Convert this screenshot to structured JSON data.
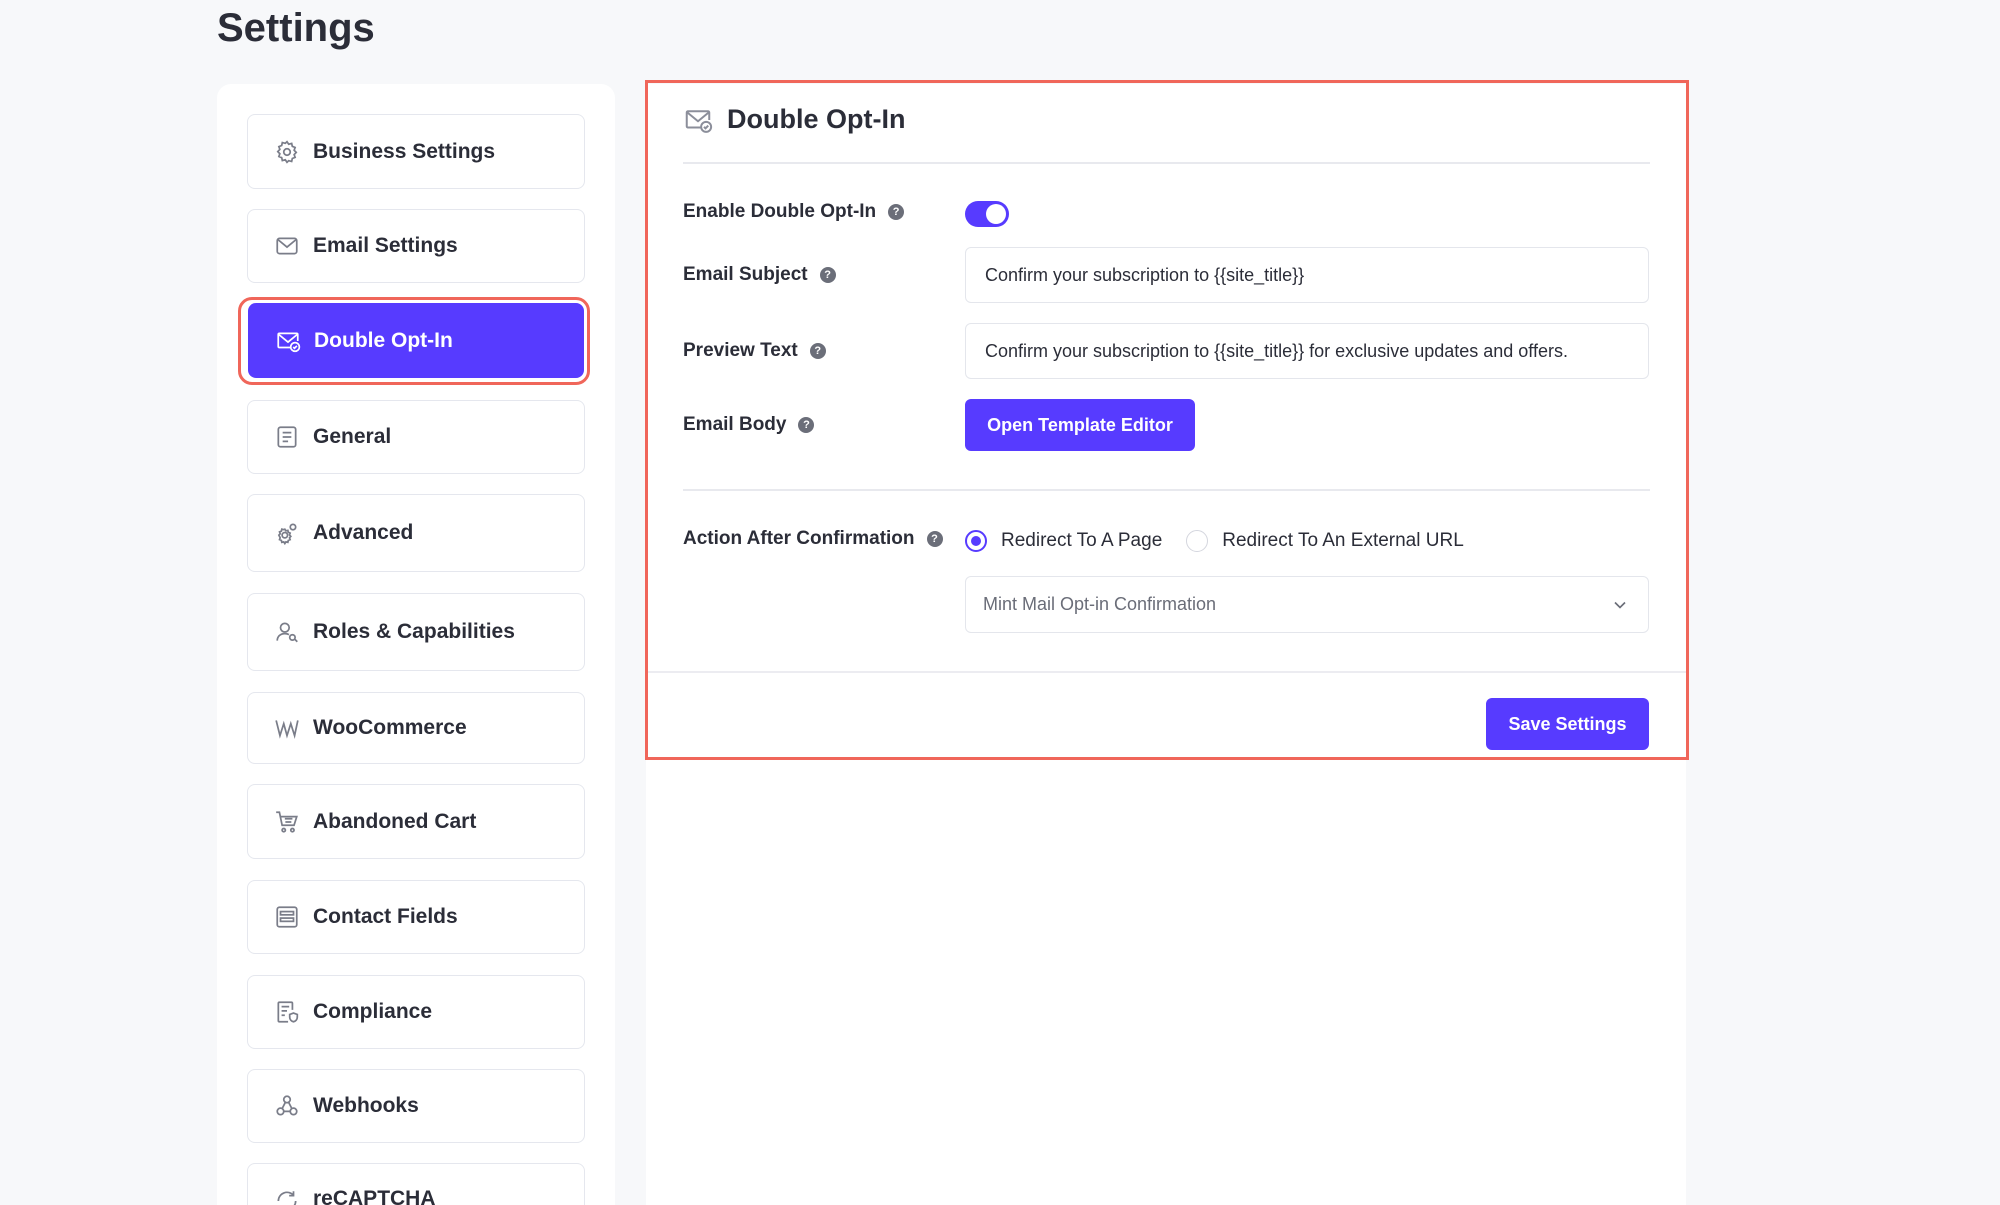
{
  "page": {
    "title": "Settings"
  },
  "sidebar": {
    "items": [
      {
        "label": "Business Settings",
        "icon": "gear-icon"
      },
      {
        "label": "Email Settings",
        "icon": "envelope-icon"
      },
      {
        "label": "Double Opt-In",
        "icon": "envelope-check-icon",
        "active": true
      },
      {
        "label": "General",
        "icon": "document-icon"
      },
      {
        "label": "Advanced",
        "icon": "gears-icon"
      },
      {
        "label": "Roles & Capabilities",
        "icon": "user-key-icon"
      },
      {
        "label": "WooCommerce",
        "icon": "woocommerce-icon"
      },
      {
        "label": "Abandoned Cart",
        "icon": "cart-icon"
      },
      {
        "label": "Contact Fields",
        "icon": "form-fields-icon"
      },
      {
        "label": "Compliance",
        "icon": "shield-document-icon"
      },
      {
        "label": "Webhooks",
        "icon": "webhook-icon"
      },
      {
        "label": "reCAPTCHA",
        "icon": "recaptcha-icon"
      }
    ]
  },
  "panel": {
    "title": "Double Opt-In",
    "enable_label": "Enable Double Opt-In",
    "enable_value": true,
    "subject_label": "Email Subject",
    "subject_value": "Confirm your subscription to {{site_title}}",
    "preview_label": "Preview Text",
    "preview_value": "Confirm your subscription to {{site_title}} for exclusive updates and offers.",
    "body_label": "Email Body",
    "body_button": "Open Template Editor",
    "action_label": "Action After Confirmation",
    "radio_page": "Redirect To A Page",
    "radio_url": "Redirect To An External URL",
    "radio_selected": "Redirect To A Page",
    "select_value": "Mint Mail Opt-in Confirmation",
    "help_glyph": "?",
    "save_button": "Save Settings"
  },
  "colors": {
    "accent": "#573bff",
    "highlight": "#f0665a"
  }
}
